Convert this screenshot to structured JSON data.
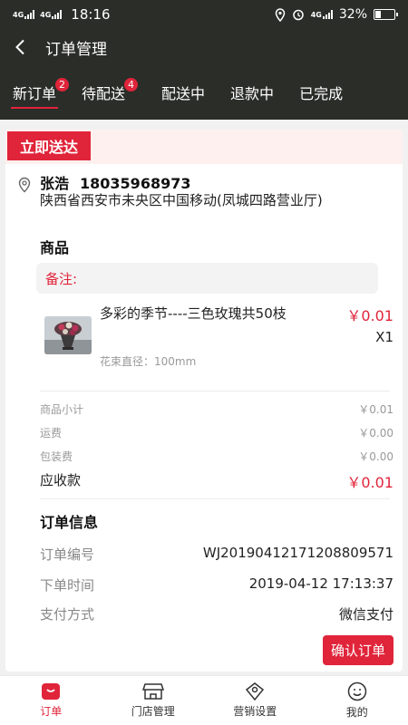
{
  "status": {
    "signal1": "4G",
    "signal2": "4G",
    "time": "18:16",
    "network": "4G",
    "battery": "32%"
  },
  "header": {
    "title": "订单管理"
  },
  "tabs": [
    {
      "label": "新订单",
      "badge": "2",
      "active": true
    },
    {
      "label": "待配送",
      "badge": "4"
    },
    {
      "label": "配送中"
    },
    {
      "label": "退款中"
    },
    {
      "label": "已完成"
    }
  ],
  "order": {
    "delivery_tag": "立即送达",
    "customer_name": "张浩",
    "customer_phone": "18035968973",
    "address": "陕西省西安市未央区中国移动(凤城四路营业厅)",
    "goods_title": "商品",
    "remark_label": "备注:",
    "product": {
      "name": "多彩的季节----三色玫瑰共50枝",
      "price": "￥0.01",
      "qty": "X1",
      "spec": "花束直径：100mm"
    },
    "fees": {
      "subtotal_label": "商品小计",
      "subtotal": "￥0.01",
      "shipping_label": "运费",
      "shipping": "￥0.00",
      "packing_label": "包装费",
      "packing": "￥0.00",
      "total_label": "应收款",
      "total": "￥0.01"
    },
    "info_title": "订单信息",
    "info": {
      "number_label": "订单编号",
      "number": "WJ20190412171208809571",
      "time_label": "下单时间",
      "time": "2019-04-12 17:13:37",
      "pay_label": "支付方式",
      "pay": "微信支付"
    },
    "confirm_label": "确认订单"
  },
  "bottom_nav": [
    {
      "label": "订单",
      "icon": "order-icon",
      "active": true
    },
    {
      "label": "门店管理",
      "icon": "store-icon"
    },
    {
      "label": "营销设置",
      "icon": "marketing-icon"
    },
    {
      "label": "我的",
      "icon": "profile-icon"
    }
  ],
  "colors": {
    "accent": "#e0243a",
    "header_bg": "#2b2d29"
  }
}
